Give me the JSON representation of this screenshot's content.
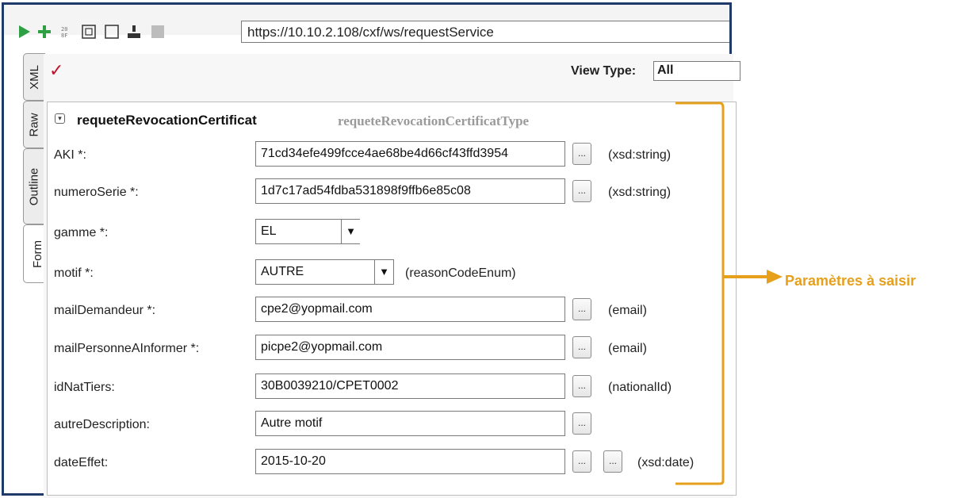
{
  "toolbar": {
    "url": "https://10.10.2.108/cxf/ws/requestService",
    "icons": [
      "play-icon",
      "add-icon",
      "encode-icon",
      "screen-icon",
      "box-icon",
      "user-icon",
      "grey-square-icon"
    ]
  },
  "tabs": [
    "XML",
    "Raw",
    "Outline",
    "Form"
  ],
  "view": {
    "label": "View Type:",
    "value": "All"
  },
  "section": {
    "name": "requeteRevocationCertificat",
    "type": "requeteRevocationCertificatType"
  },
  "fields": [
    {
      "label": "AKI *:",
      "value": "71cd34efe499fcce4ae68be4d66cf43ffd3954",
      "hint": "(xsd:string)"
    },
    {
      "label": "numeroSerie *:",
      "value": "1d7c17ad54fdba531898f9ffb6e85c08",
      "hint": "(xsd:string)"
    },
    {
      "label": "gamme *:",
      "value": "EL",
      "hint": ""
    },
    {
      "label": "motif *:",
      "value": "AUTRE",
      "hint": "(reasonCodeEnum)"
    },
    {
      "label": "mailDemandeur *:",
      "value": "cpe2@yopmail.com",
      "hint": "(email)"
    },
    {
      "label": "mailPersonneAInformer *:",
      "value": "picpe2@yopmail.com",
      "hint": "(email)"
    },
    {
      "label": "idNatTiers:",
      "value": "30B0039210/CPET0002",
      "hint": "(nationalId)"
    },
    {
      "label": "autreDescription:",
      "value": "Autre motif",
      "hint": ""
    },
    {
      "label": "dateEffet:",
      "value": "2015-10-20",
      "hint": "(xsd:date)"
    }
  ],
  "ellipsis_label": "...",
  "annotation": "Paramètres à saisir",
  "colors": {
    "window_border": "#1f3a68",
    "annotation": "#e6a01c",
    "checkmark": "#c0102a",
    "play": "#2ea043"
  }
}
